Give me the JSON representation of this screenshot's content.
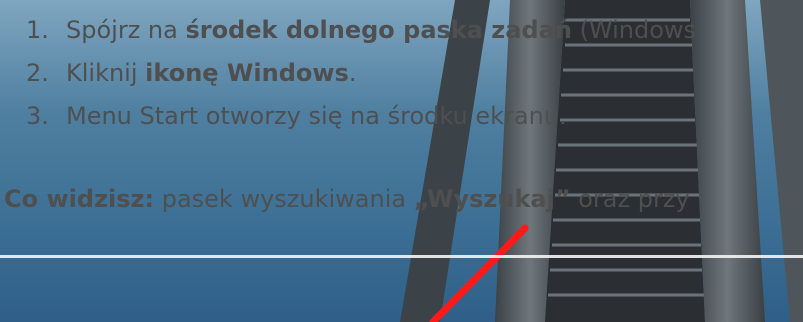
{
  "steps": [
    {
      "number": "1.",
      "pre": "Spójrz na ",
      "bold": "środek dolnego paska zadań",
      "post": " (Windows"
    },
    {
      "number": "2.",
      "pre": "Kliknij ",
      "bold": "ikonę Windows",
      "post": "."
    },
    {
      "number": "3.",
      "pre": "Menu Start otworzy się na środku ekranu.",
      "bold": "",
      "post": ""
    }
  ],
  "info": {
    "label": "Co widzisz:",
    "pre": " pasek wyszukiwania ",
    "bold": "„Wyszukaj”",
    "post": " oraz przy"
  },
  "colors": {
    "text": "#4f4f4f",
    "sky": "#3c6f95",
    "pointer": "#ff1a1a",
    "divider": "#f4f4f4"
  }
}
